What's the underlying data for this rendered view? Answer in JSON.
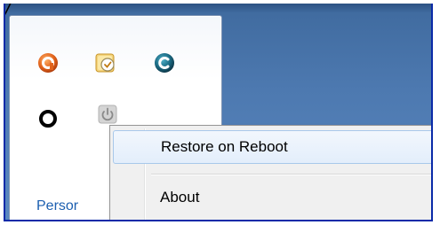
{
  "tray": {
    "icons": [
      {
        "name": "orange-ring-app-icon",
        "color": "#e2641c"
      },
      {
        "name": "clock-note-icon",
        "color": "#e9b73a"
      },
      {
        "name": "teal-c-app-icon",
        "color": "#1c6d86"
      },
      {
        "name": "black-ring-icon",
        "color": "#000000"
      },
      {
        "name": "power-icon",
        "color": "#9a9a9a"
      }
    ],
    "link_text": "Persor"
  },
  "context_menu": {
    "items": [
      {
        "label": "Restore on Reboot",
        "highlighted": true
      },
      {
        "label": "About",
        "highlighted": false
      }
    ]
  },
  "colors": {
    "desktop": "#4d79b0",
    "link": "#1c5fb0",
    "menu_highlight_border": "#a8c8ea",
    "frame_border": "#0a2aa8"
  }
}
